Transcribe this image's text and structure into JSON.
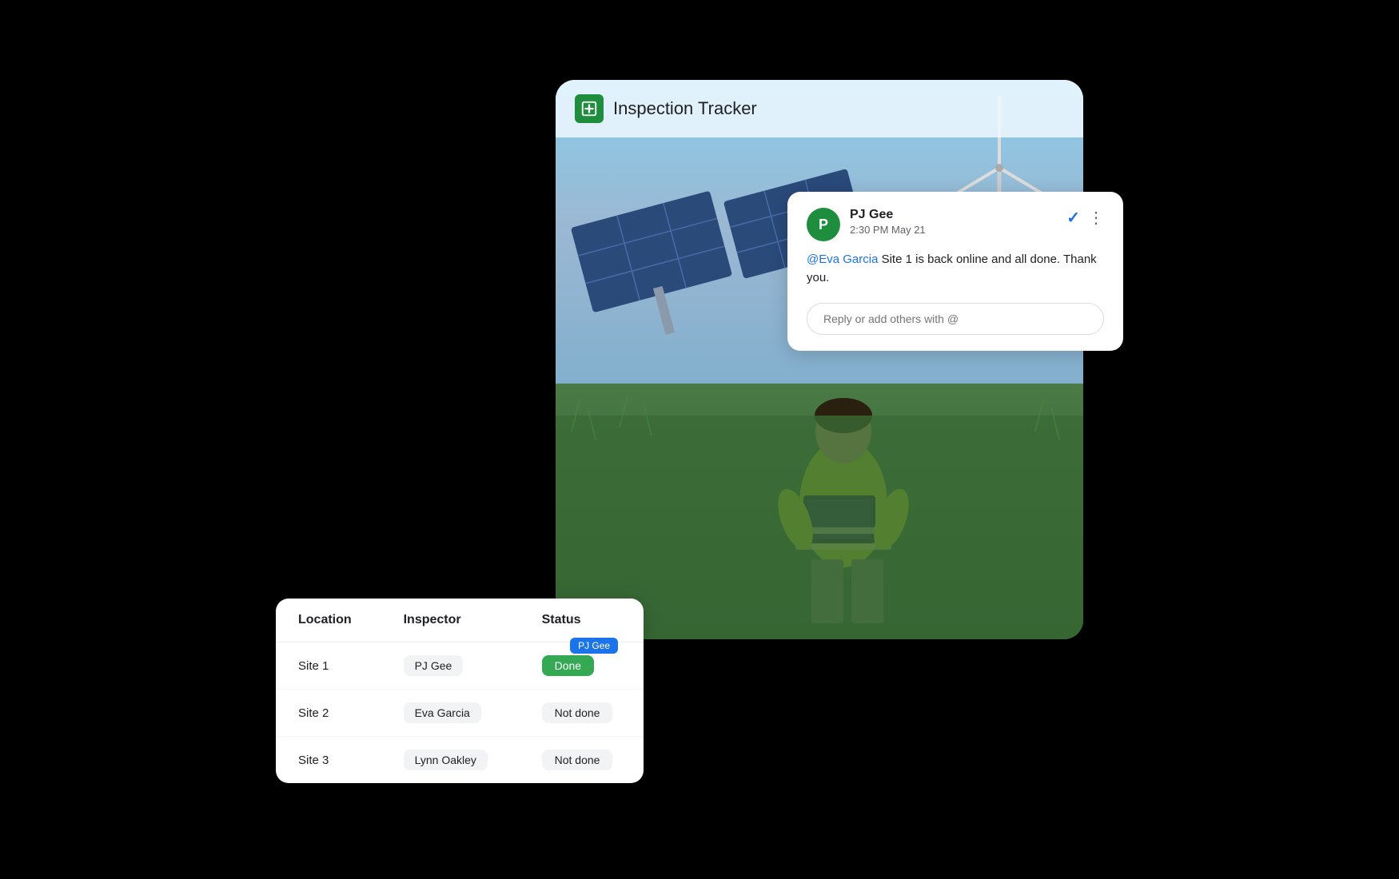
{
  "tracker": {
    "title": "Inspection Tracker",
    "icon_label": "table-icon"
  },
  "comment_card": {
    "commenter_initial": "P",
    "commenter_name": "PJ Gee",
    "comment_time": "2:30 PM May 21",
    "mention": "@Eva Garcia",
    "comment_body": " Site 1 is back online and all done. Thank you.",
    "reply_placeholder": "Reply or add others with @",
    "check_icon": "✓",
    "more_icon": "⋮"
  },
  "table": {
    "columns": [
      "Location",
      "Inspector",
      "Status"
    ],
    "rows": [
      {
        "location": "Site 1",
        "inspector": "PJ Gee",
        "status": "Done",
        "status_type": "done",
        "badge": "PJ Gee"
      },
      {
        "location": "Site 2",
        "inspector": "Eva Garcia",
        "status": "Not done",
        "status_type": "not-done",
        "badge": ""
      },
      {
        "location": "Site 3",
        "inspector": "Lynn Oakley",
        "status": "Not done",
        "status_type": "not-done",
        "badge": ""
      }
    ]
  },
  "colors": {
    "green_accent": "#1e8e3e",
    "blue_accent": "#1a73e8",
    "done_bg": "#34a853"
  }
}
